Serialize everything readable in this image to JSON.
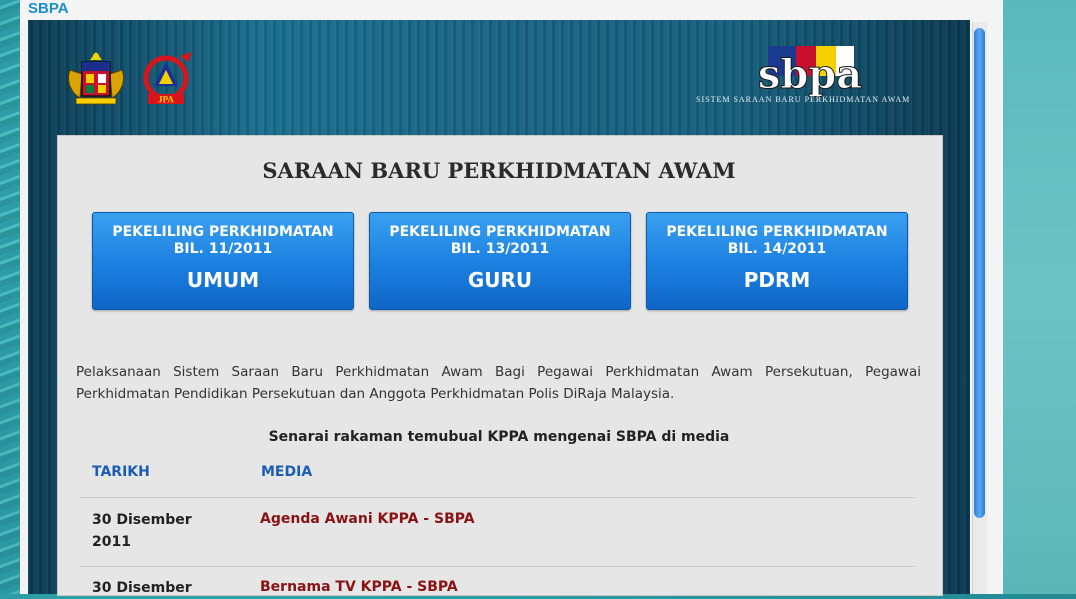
{
  "window": {
    "title": "SBPA"
  },
  "header": {
    "logo_text": "sbpa",
    "subtitle": "SISTEM SARAAN BARU PERKHIDMATAN AWAM",
    "jpa_label": "JPA"
  },
  "main": {
    "title": "SARAAN BARU PERKHIDMATAN AWAM",
    "buttons": [
      {
        "line1": "PEKELILING PERKHIDMATAN",
        "line2": "BIL. 11/2011",
        "label": "UMUM"
      },
      {
        "line1": "PEKELILING PERKHIDMATAN",
        "line2": "BIL. 13/2011",
        "label": "GURU"
      },
      {
        "line1": "PEKELILING PERKHIDMATAN",
        "line2": "BIL. 14/2011",
        "label": "PDRM"
      }
    ],
    "intro": "Pelaksanaan Sistem Saraan Baru Perkhidmatan Awam Bagi Pegawai Perkhidmatan Awam Persekutuan, Pegawai Perkhidmatan Pendidikan Persekutuan dan Anggota Perkhidmatan Polis DiRaja Malaysia.",
    "table": {
      "heading": "Senarai rakaman temubual KPPA mengenai SBPA di media",
      "columns": [
        "TARIKH",
        "MEDIA"
      ],
      "rows": [
        {
          "date": "30 Disember 2011",
          "media": "Agenda Awani KPPA - SBPA"
        },
        {
          "date": "30 Disember",
          "media": "Bernama TV KPPA - SBPA"
        }
      ]
    }
  },
  "colors": {
    "button": "#1b7fe0",
    "link": "#8b1212",
    "column_header": "#1b5db5",
    "title_blue": "#1a8fd0"
  }
}
